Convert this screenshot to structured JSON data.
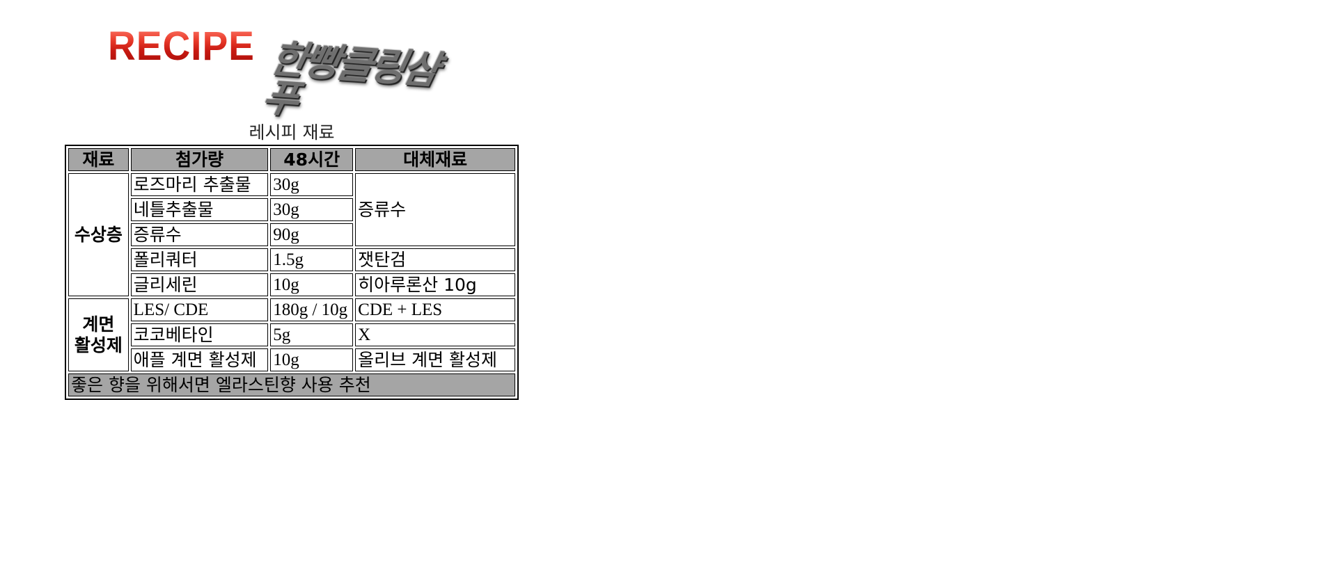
{
  "logos": {
    "recipe": "RECIPE",
    "product": "한빵클링샴푸"
  },
  "table": {
    "caption": "레시피 재료",
    "headers": [
      "재료",
      "첨가량",
      "48시간",
      "대체재료"
    ],
    "groups": {
      "water_phase": "수상층",
      "surfactant_line1": "계면",
      "surfactant_line2": "활성제"
    },
    "rows": [
      {
        "ingredient": "로즈마리 추출물",
        "amount": "30g",
        "substitute": "증류수"
      },
      {
        "ingredient": "네틀추출물",
        "amount": "30g"
      },
      {
        "ingredient": "증류수",
        "amount": "90g"
      },
      {
        "ingredient": "폴리쿼터",
        "amount": "1.5g",
        "substitute": "잿탄검"
      },
      {
        "ingredient": "글리세린",
        "amount": "10g",
        "substitute": "히아루론산 10g"
      },
      {
        "ingredient": "LES/ CDE",
        "amount": "180g / 10g",
        "substitute": "CDE + LES"
      },
      {
        "ingredient": "코코베타인",
        "amount": "5g",
        "substitute": "X"
      },
      {
        "ingredient": "애플 계면 활성제",
        "amount": "10g",
        "substitute": "올리브 계면 활성제"
      }
    ],
    "footnote": "좋은 향을 위해서면 엘라스틴향 사용 추천"
  },
  "colors": {
    "header_bg": "#a5a5a5",
    "logo_red": "#d42a1e",
    "logo_gray": "#6f6f6f"
  }
}
